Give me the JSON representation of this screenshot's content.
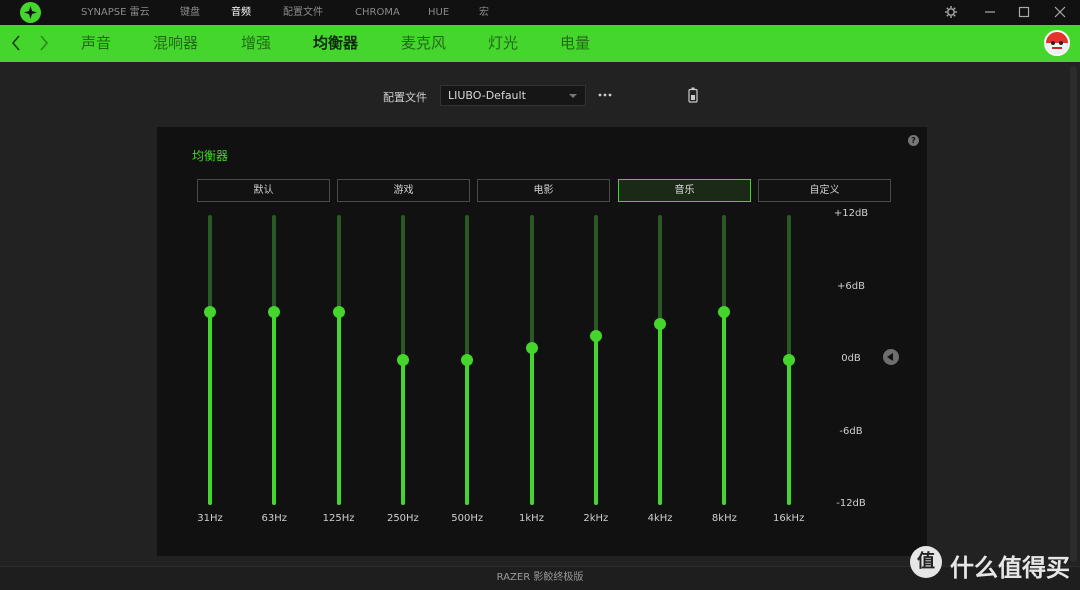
{
  "topbar": {
    "nav": [
      "SYNAPSE 雷云",
      "键盘",
      "音频",
      "配置文件",
      "CHROMA",
      "HUE",
      "宏"
    ],
    "active_index": 2
  },
  "subnav": {
    "tabs": [
      "声音",
      "混响器",
      "增强",
      "均衡器",
      "麦克风",
      "灯光",
      "电量"
    ],
    "active_index": 3
  },
  "profile": {
    "label": "配置文件",
    "value": "LIUBO-Default"
  },
  "equalizer": {
    "title": "均衡器",
    "presets": [
      "默认",
      "游戏",
      "电影",
      "音乐",
      "自定义"
    ],
    "active_preset": "音乐",
    "db_range": [
      -12,
      12
    ],
    "db_labels": [
      "+12dB",
      "+6dB",
      "0dB",
      "-6dB",
      "-12dB"
    ],
    "bands": [
      {
        "freq": "31Hz",
        "gain_db": 4
      },
      {
        "freq": "63Hz",
        "gain_db": 4
      },
      {
        "freq": "125Hz",
        "gain_db": 4
      },
      {
        "freq": "250Hz",
        "gain_db": 0
      },
      {
        "freq": "500Hz",
        "gain_db": 0
      },
      {
        "freq": "1kHz",
        "gain_db": 1
      },
      {
        "freq": "2kHz",
        "gain_db": 2
      },
      {
        "freq": "4kHz",
        "gain_db": 3
      },
      {
        "freq": "8kHz",
        "gain_db": 4
      },
      {
        "freq": "16kHz",
        "gain_db": 0
      }
    ]
  },
  "footer": {
    "text": "RAZER 影鲛终极版"
  },
  "watermark": {
    "text": "什么值得买"
  },
  "colors": {
    "accent": "#44d62c",
    "panel": "#111111",
    "background": "#222222"
  }
}
